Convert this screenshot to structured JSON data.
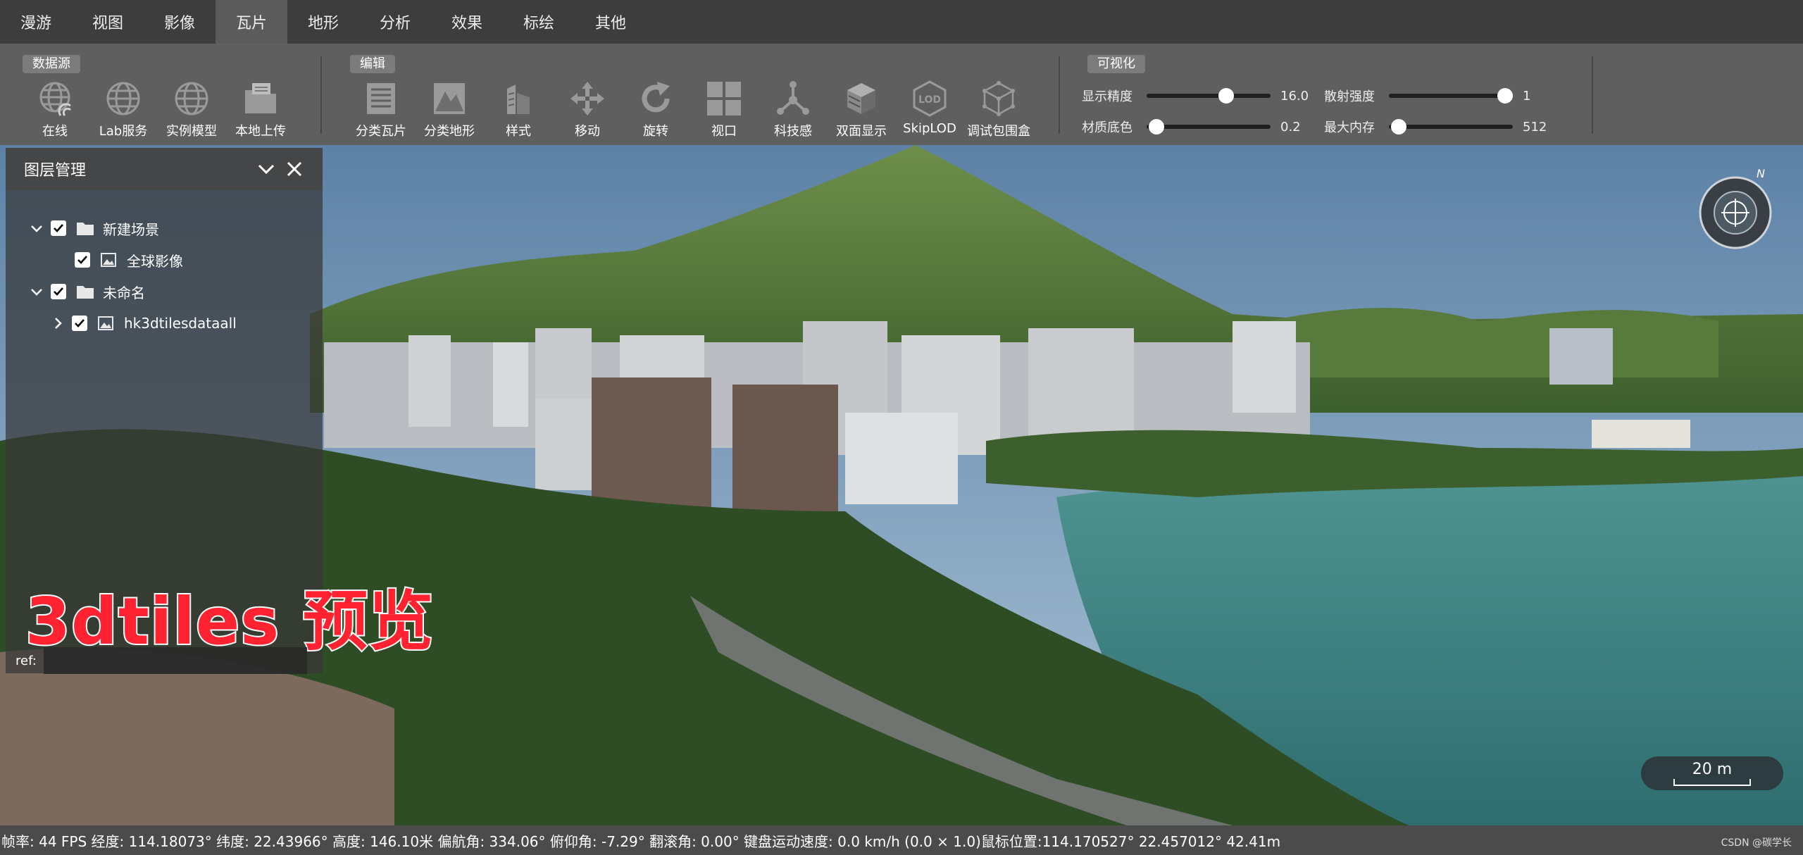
{
  "menu": {
    "tabs": [
      {
        "label": "漫游"
      },
      {
        "label": "视图"
      },
      {
        "label": "影像"
      },
      {
        "label": "瓦片",
        "active": true
      },
      {
        "label": "地形"
      },
      {
        "label": "分析"
      },
      {
        "label": "效果"
      },
      {
        "label": "标绘"
      },
      {
        "label": "其他"
      }
    ]
  },
  "ribbon": {
    "groups": {
      "datasource": "数据源",
      "edit": "编辑",
      "visual": "可视化"
    },
    "datasource_tools": [
      {
        "label": "在线",
        "icon": "globe-online-icon"
      },
      {
        "label": "Lab服务",
        "icon": "globe-icon"
      },
      {
        "label": "实例模型",
        "icon": "globe-grid-icon"
      },
      {
        "label": "本地上传",
        "icon": "folder-upload-icon"
      }
    ],
    "edit_tools": [
      {
        "label": "分类瓦片",
        "icon": "classify-tiles-icon"
      },
      {
        "label": "分类地形",
        "icon": "classify-terrain-icon"
      },
      {
        "label": "样式",
        "icon": "style-icon"
      },
      {
        "label": "移动",
        "icon": "move-icon"
      },
      {
        "label": "旋转",
        "icon": "rotate-icon"
      },
      {
        "label": "视口",
        "icon": "viewport-icon"
      },
      {
        "label": "科技感",
        "icon": "tech-icon"
      },
      {
        "label": "双面显示",
        "icon": "double-side-icon"
      },
      {
        "label": "SkipLOD",
        "icon": "lod-icon"
      },
      {
        "label": "调试包围盒",
        "icon": "bounding-box-icon"
      }
    ],
    "sliders": {
      "display_precision": {
        "label": "显示精度",
        "value": "16.0",
        "fraction": 0.66
      },
      "scatter_strength": {
        "label": "散射强度",
        "value": "1",
        "fraction": 1.0
      },
      "material_base": {
        "label": "材质底色",
        "value": "0.2",
        "fraction": 0.02
      },
      "max_memory": {
        "label": "最大内存",
        "value": "512",
        "fraction": 0.02
      }
    }
  },
  "layer_panel": {
    "title": "图层管理",
    "tree": [
      {
        "label": "新建场景",
        "type": "folder",
        "checked": true,
        "expanded": true
      },
      {
        "label": "全球影像",
        "type": "image",
        "checked": true
      },
      {
        "label": "未命名",
        "type": "folder",
        "checked": true,
        "expanded": true
      },
      {
        "label": "hk3dtilesdataall",
        "type": "image",
        "checked": true,
        "expanded": false
      }
    ],
    "ref_label": "ref:",
    "ref_value": ""
  },
  "caption": "3dtiles 预览",
  "compass": {
    "north_label": "N"
  },
  "scale": {
    "label": "20 m"
  },
  "status": {
    "text": "帧率: 44 FPS 经度: 114.18073° 纬度: 22.43966° 高度: 146.10米 偏航角: 334.06° 俯仰角: -7.29° 翻滚角: 0.00° 键盘运动速度: 0.0 km/h (0.0 × 1.0)鼠标位置:114.170527° 22.457012° 42.41m"
  },
  "watermark": "CSDN @碳学长",
  "colors": {
    "menubar": "#3d3d3d",
    "ribbon": "#5f5f5f",
    "caption_red": "#ff2230",
    "sky": "#6f93b4",
    "water": "#3e8a86"
  }
}
